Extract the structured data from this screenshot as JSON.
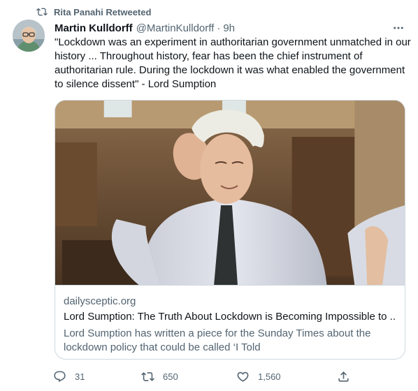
{
  "retweet": {
    "label": "Rita Panahi Retweeted",
    "icon": "retweet-icon"
  },
  "tweet": {
    "author_name": "Martin Kulldorff",
    "author_handle": "@MartinKulldorff",
    "separator": "·",
    "time": "9h",
    "avatar_icon": "avatar-photo",
    "more_icon": "more-dots-icon",
    "text": "\"Lockdown was an experiment in authoritarian government unmatched in our history ... Throughout history, fear has been the chief instrument of authoritarian rule. During the lockdown it was what enabled the government to silence dissent\" - Lord Sumption"
  },
  "card": {
    "domain": "dailysceptic.org",
    "title": "Lord Sumption: The Truth About Lockdown is Becoming Impossible to ...",
    "description": "Lord Sumption has written a piece for the Sunday Times about the lockdown policy that could be called ‘I Told"
  },
  "actions": {
    "reply_count": "31",
    "retweet_count": "650",
    "like_count": "1,560"
  },
  "colors": {
    "text_primary": "#0f1419",
    "text_secondary": "#536471",
    "border": "#cfd9de"
  }
}
